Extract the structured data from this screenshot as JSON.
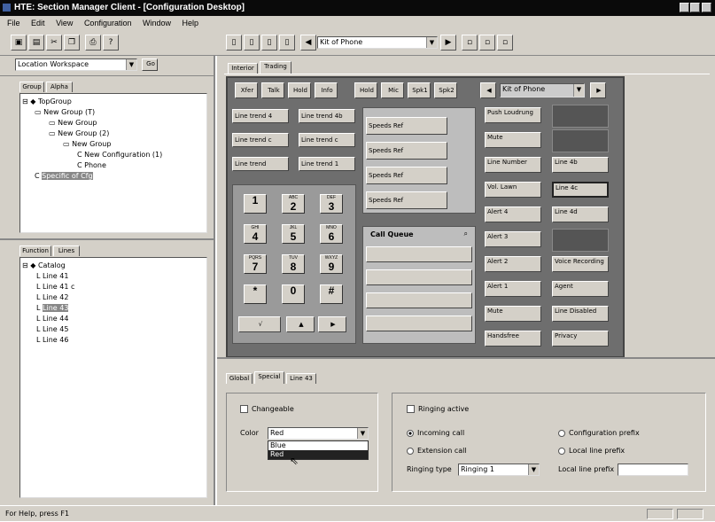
{
  "window": {
    "title": "HTE: Section Manager Client - [Configuration Desktop]"
  },
  "menu": [
    "File",
    "Edit",
    "View",
    "Configuration",
    "Window",
    "Help"
  ],
  "toolbar": {
    "phone_select": "Kit of Phone"
  },
  "left": {
    "location_select": "Location Workspace",
    "location_button": "Go",
    "top_tabs": [
      "Group",
      "Alpha"
    ],
    "group_tree": [
      {
        "label": "TopGroup",
        "depth": 0
      },
      {
        "label": "New Group (T)",
        "depth": 1
      },
      {
        "label": "New Group",
        "depth": 2
      },
      {
        "label": "New Group (2)",
        "depth": 2
      },
      {
        "label": "New Group",
        "depth": 3
      },
      {
        "label": "New Configuration (1)",
        "depth": 4
      },
      {
        "label": "Phone",
        "depth": 4
      },
      {
        "label": "Specific of Cfg",
        "depth": 1,
        "selected": true
      }
    ],
    "bottom_tabs": [
      "Function",
      "Lines"
    ],
    "catalog_tree": [
      {
        "label": "Catalog",
        "depth": 0
      },
      {
        "label": "Line 41",
        "depth": 1
      },
      {
        "label": "Line 41 c",
        "depth": 1
      },
      {
        "label": "Line 42",
        "depth": 1
      },
      {
        "label": "Line 43",
        "depth": 1,
        "selected": true
      },
      {
        "label": "Line 44",
        "depth": 1
      },
      {
        "label": "Line 45",
        "depth": 1
      },
      {
        "label": "Line 46",
        "depth": 1
      }
    ]
  },
  "phone": {
    "tabs": [
      "Interior",
      "Trading"
    ],
    "top_icons": [
      "Xfer",
      "Talk",
      "Hold",
      "Info"
    ],
    "mid_icons": [
      "Hold",
      "Mic",
      "Spk1",
      "Spk2"
    ],
    "nav_select": "Kit of Phone",
    "line_buttons": [
      [
        "Line trend 4",
        "Line trend 4b"
      ],
      [
        "Line trend c",
        "Line trend c"
      ],
      [
        "Line trend",
        "Line trend 1"
      ]
    ],
    "speed_dials": [
      "Speeds Ref",
      "Speeds Ref",
      "Speeds Ref",
      "Speeds Ref"
    ],
    "keypad": [
      {
        "sub": "",
        "main": "1"
      },
      {
        "sub": "ABC",
        "main": "2"
      },
      {
        "sub": "DEF",
        "main": "3"
      },
      {
        "sub": "GHI",
        "main": "4"
      },
      {
        "sub": "JKL",
        "main": "5"
      },
      {
        "sub": "MNO",
        "main": "6"
      },
      {
        "sub": "PQRS",
        "main": "7"
      },
      {
        "sub": "TUV",
        "main": "8"
      },
      {
        "sub": "WXYZ",
        "main": "9"
      },
      {
        "sub": "",
        "main": "*"
      },
      {
        "sub": "",
        "main": "0"
      },
      {
        "sub": "",
        "main": "#"
      }
    ],
    "call_queue_label": "Call Queue",
    "func_col1": [
      "Push Loudrung",
      "Mute",
      "Line Number",
      "Vol. Lawn",
      "Alert 4",
      "Alert 3",
      "Alert 2",
      "Alert 1",
      "Mute",
      "Handsfree"
    ],
    "func_col2": [
      "",
      "",
      "Line 4b",
      "Line 4c",
      "Line 4d",
      "",
      "Voice Recording",
      "Agent",
      "Line Disabled",
      "Privacy"
    ]
  },
  "props": {
    "tabs": [
      "Global",
      "Special",
      "Line 43"
    ],
    "changeable_label": "Changeable",
    "color_label": "Color",
    "color_value": "Red",
    "color_options": [
      "Blue",
      "Red"
    ],
    "ringing_label": "Ringing active",
    "radio_options": [
      "Incoming call",
      "Extension call",
      "Configuration prefix",
      "Local line prefix"
    ],
    "ringing_type_label": "Ringing type",
    "ringing_type_value": "Ringing 1",
    "local_prefix_label": "Local line prefix",
    "local_prefix_value": ""
  },
  "status": {
    "text": "For Help, press F1"
  }
}
